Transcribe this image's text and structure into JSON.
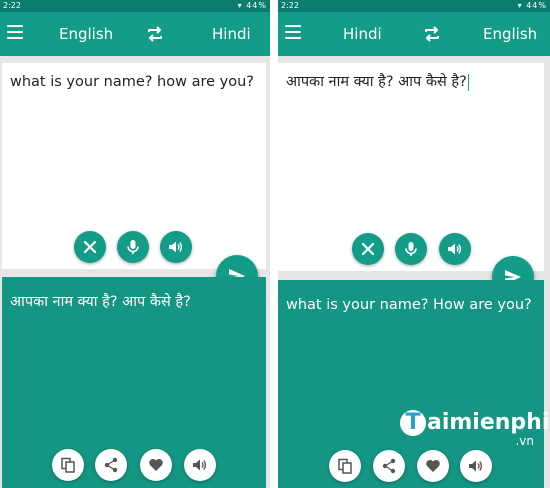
{
  "colors": {
    "primary": "#139d89",
    "status_bar": "#0b7d6e",
    "output_card": "#159583",
    "input_card": "#ffffff"
  },
  "screens": [
    {
      "status_bar": {
        "time": "2:22",
        "battery": "44%"
      },
      "app_bar": {
        "source_language": "English",
        "target_language": "Hindi",
        "icons": [
          "menu-icon",
          "swap-icon"
        ]
      },
      "input_text": "what is your name? how are you?",
      "output_text": "आपका नाम क्या है? आप कैसे है?",
      "input_actions": [
        "close-icon",
        "microphone-icon",
        "speaker-icon"
      ],
      "output_actions": [
        "copy-icon",
        "share-icon",
        "heart-icon",
        "speaker-icon"
      ],
      "fab": "send-icon"
    },
    {
      "status_bar": {
        "time": "2:22",
        "battery": "44%"
      },
      "app_bar": {
        "source_language": "Hindi",
        "target_language": "English",
        "icons": [
          "menu-icon",
          "swap-icon"
        ]
      },
      "input_text": "आपका नाम क्या है? आप कैसे है?",
      "output_text": "what is your name? How are you?",
      "input_actions": [
        "close-icon",
        "microphone-icon",
        "speaker-icon"
      ],
      "output_actions": [
        "copy-icon",
        "share-icon",
        "heart-icon",
        "speaker-icon"
      ],
      "fab": "send-icon"
    }
  ],
  "watermark": {
    "initial": "T",
    "word": "aimienphi",
    "suffix": ".vn"
  }
}
